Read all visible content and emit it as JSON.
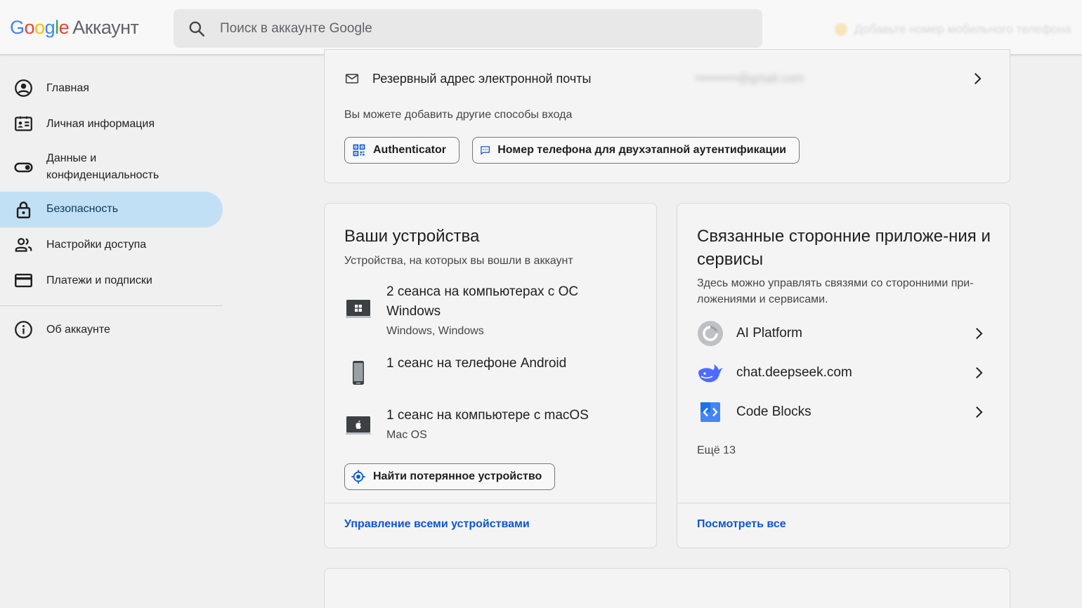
{
  "header": {
    "logo_letters": [
      "G",
      "o",
      "o",
      "g",
      "l",
      "e"
    ],
    "logo_suffix": "Аккаунт",
    "search_placeholder": "Поиск в аккаунте Google",
    "right_notice": "Добавьте номер мобильного телефона"
  },
  "sidebar": {
    "items": [
      {
        "label": "Главная",
        "icon": "account-circle-icon"
      },
      {
        "label": "Личная информация",
        "icon": "id-card-icon"
      },
      {
        "label": "Данные и конфиденциальность",
        "icon": "toggle-icon"
      },
      {
        "label": "Безопасность",
        "icon": "lock-icon",
        "active": true
      },
      {
        "label": "Настройки доступа",
        "icon": "people-icon"
      },
      {
        "label": "Платежи и подписки",
        "icon": "credit-card-icon"
      },
      {
        "label": "Об аккаунте",
        "icon": "info-icon"
      }
    ]
  },
  "signin": {
    "recovery_label": "Резервный адрес электронной почты",
    "recovery_value": "••••••••••@gmail.com",
    "add_methods_text": "Вы можете добавить другие способы входа",
    "chip_authenticator": "Authenticator",
    "chip_phone": "Номер телефона для двухэтапной аутентификации"
  },
  "devices": {
    "title": "Ваши устройства",
    "subtitle": "Устройства, на которых вы вошли в аккаунт",
    "items": [
      {
        "title": "2 сеанса на компьютерах с ОС Windows",
        "subtitle": "Windows, Windows",
        "icon": "windows-laptop-icon"
      },
      {
        "title": "1 сеанс на телефоне Android",
        "subtitle": "",
        "icon": "android-phone-icon"
      },
      {
        "title": "1 сеанс на компьютере с macOS",
        "subtitle": "Mac OS",
        "icon": "mac-laptop-icon"
      }
    ],
    "find_button": "Найти потерянное устройство",
    "manage_link": "Управление всеми устройствами"
  },
  "apps": {
    "title": "Связанные сторонние приложе-ния и сервисы",
    "subtitle": "Здесь можно управлять связями со сторонними при-ложениями и сервисами.",
    "items": [
      {
        "label": "AI Platform",
        "icon": "ai-platform-icon"
      },
      {
        "label": "chat.deepseek.com",
        "icon": "deepseek-whale-icon"
      },
      {
        "label": "Code Blocks",
        "icon": "code-blocks-icon"
      }
    ],
    "more": "Ещё 13",
    "view_all": "Посмотреть все"
  },
  "colors": {
    "active_nav_bg": "#c2e0f5",
    "link_blue": "#0b57d0",
    "page_bg": "#f0f0f0"
  }
}
